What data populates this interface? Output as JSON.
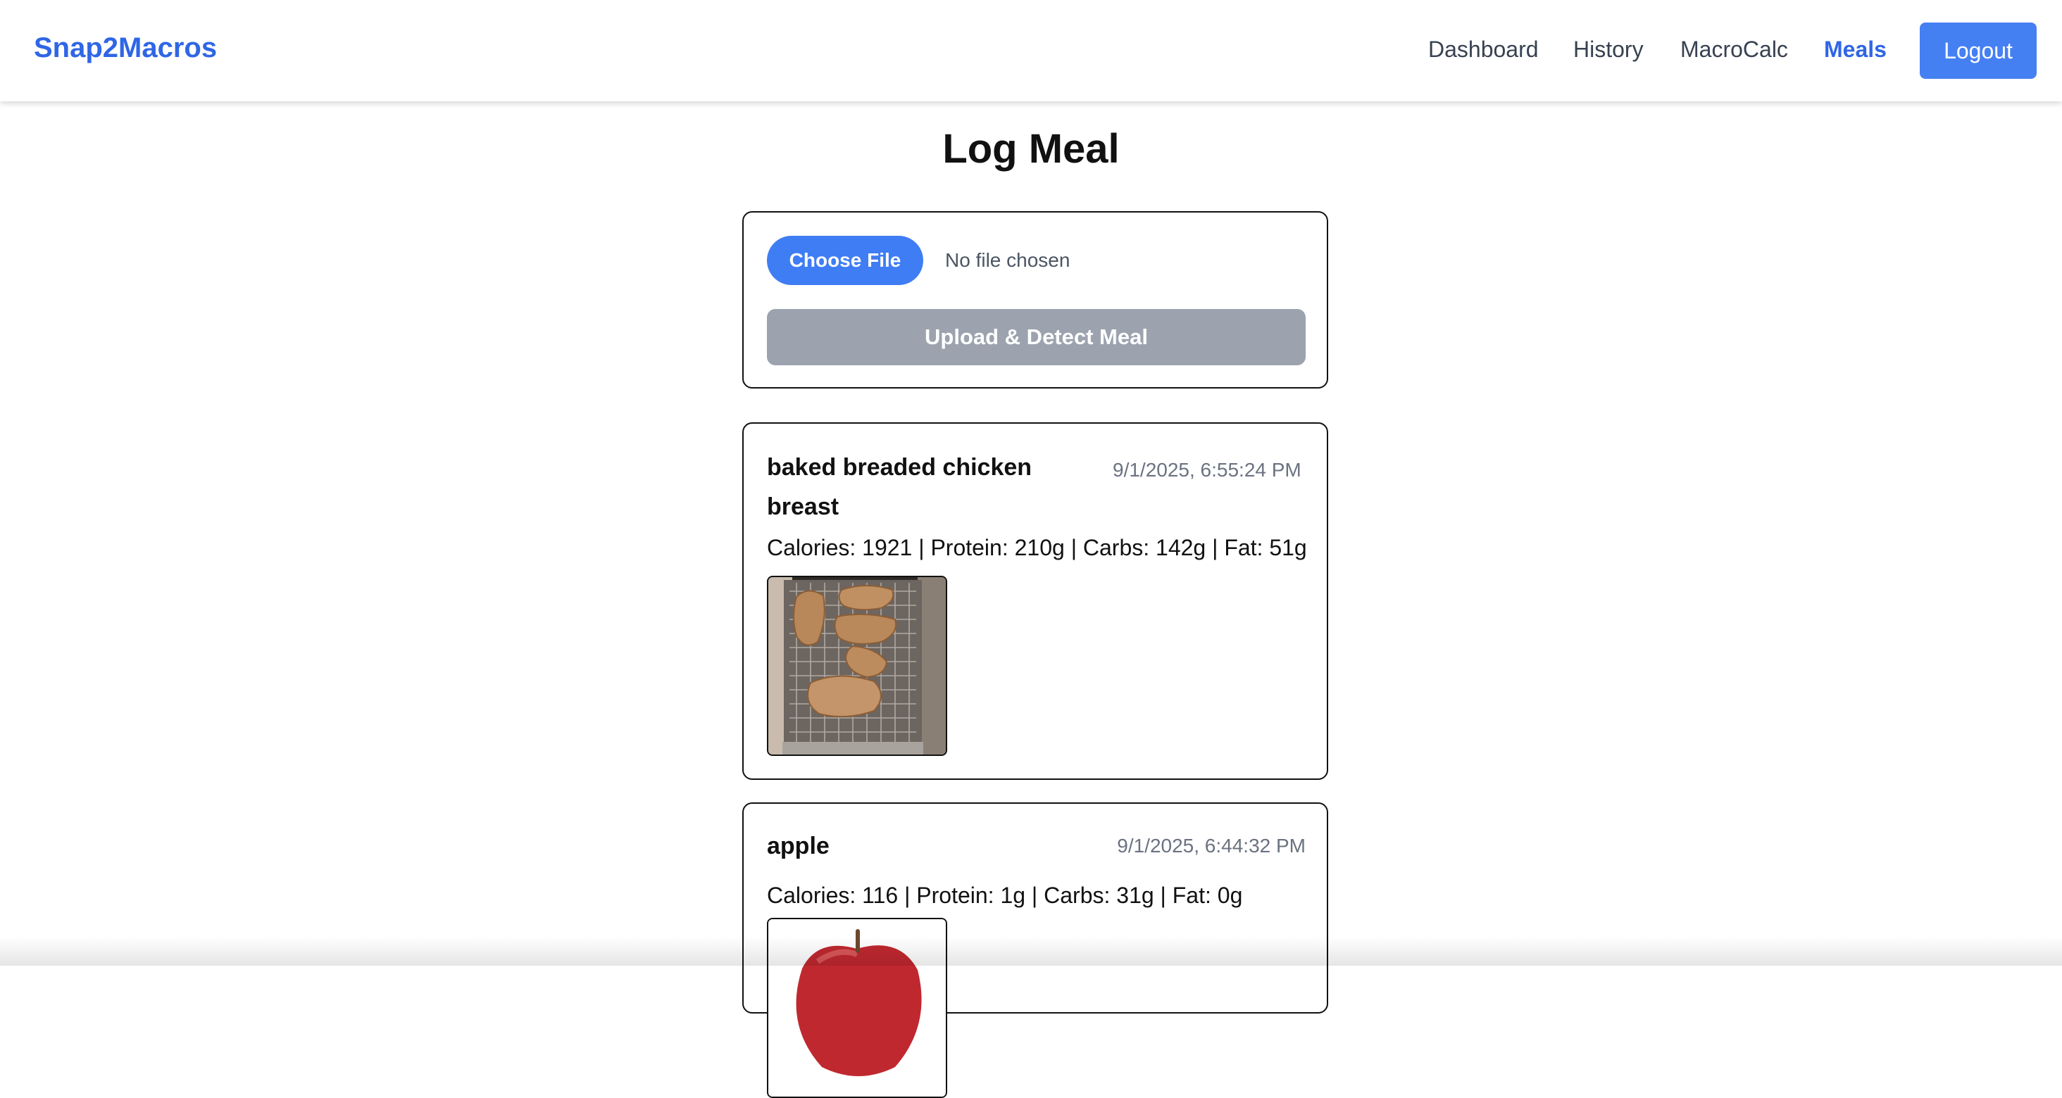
{
  "navbar": {
    "brand": "Snap2Macros",
    "links": [
      {
        "label": "Dashboard",
        "active": false
      },
      {
        "label": "History",
        "active": false
      },
      {
        "label": "MacroCalc",
        "active": false
      },
      {
        "label": "Meals",
        "active": true
      }
    ],
    "logout_label": "Logout"
  },
  "page": {
    "title": "Log Meal"
  },
  "upload": {
    "choose_label": "Choose File",
    "file_status": "No file chosen",
    "submit_label": "Upload & Detect Meal"
  },
  "meals": [
    {
      "name": "baked breaded chicken breast",
      "timestamp": "9/1/2025, 6:55:24 PM",
      "macros": "Calories: 1921 | Protein: 210g | Carbs: 142g | Fat: 51g",
      "photo_icon": "breaded-chicken-photo"
    },
    {
      "name": "apple",
      "timestamp": "9/1/2025, 6:44:32 PM",
      "macros": "Calories: 116 | Protein: 1g | Carbs: 31g | Fat: 0g",
      "photo_icon": "apple-photo"
    }
  ],
  "colors": {
    "accent": "#2f66e6",
    "button": "#4580f3",
    "disabled_button": "#9ca3af"
  }
}
